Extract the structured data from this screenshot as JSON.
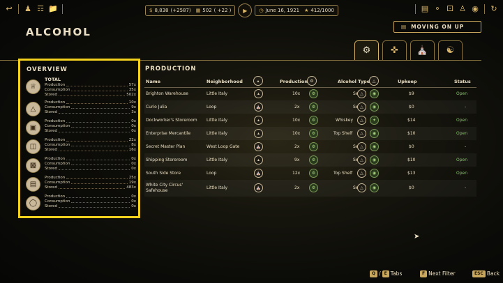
{
  "topbar": {
    "money": "8,838",
    "money_delta": "(+2587)",
    "workers": "502",
    "workers_delta": "( +22 )",
    "date": "June 16, 1921",
    "stars": "412/1000"
  },
  "page": {
    "title": "ALCOHOL"
  },
  "moving_on_up": {
    "label": "MOVING ON UP"
  },
  "overview": {
    "title": "OVERVIEW",
    "total_label": "TOTAL",
    "labels": {
      "production": "Production",
      "consumption": "Consumption",
      "stored": "Stored"
    },
    "items": [
      {
        "icon": "crown-icon",
        "production": "57x",
        "consumption": "35x",
        "stored": "502x"
      },
      {
        "icon": "bottle-icon",
        "production": "10x",
        "consumption": "9x",
        "stored": "3x"
      },
      {
        "icon": "crate-icon",
        "production": "0x",
        "consumption": "0x",
        "stored": "0x"
      },
      {
        "icon": "barrel-icon",
        "production": "22x",
        "consumption": "8x",
        "stored": "16x"
      },
      {
        "icon": "jug-icon",
        "production": "0x",
        "consumption": "0x",
        "stored": "0x"
      },
      {
        "icon": "keg-icon",
        "production": "25x",
        "consumption": "19x",
        "stored": "483x"
      },
      {
        "icon": "flask-icon",
        "production": "0x",
        "consumption": "0x",
        "stored": "0x"
      }
    ]
  },
  "production": {
    "title": "PRODUCTION",
    "columns": {
      "name": "Name",
      "neighborhood": "Neighborhood",
      "production": "Production",
      "alcohol_type": "Alcohol Type",
      "upkeep": "Upkeep",
      "status": "Status"
    },
    "rows": [
      {
        "name": "Brighton Warehouse",
        "neighborhood": "Little Italy",
        "production": "10x",
        "alcohol_type": "Swill",
        "upkeep": "$9",
        "status": "Open"
      },
      {
        "name": "Curio Julia",
        "neighborhood": "Loop",
        "production": "2x",
        "alcohol_type": "Swill",
        "upkeep": "$0",
        "status": "-"
      },
      {
        "name": "Dockworker's Storeroom",
        "neighborhood": "Little Italy",
        "production": "10x",
        "alcohol_type": "Whiskey",
        "upkeep": "$14",
        "status": "Open"
      },
      {
        "name": "Enterprise Mercantile",
        "neighborhood": "Little Italy",
        "production": "10x",
        "alcohol_type": "Top Shelf",
        "upkeep": "$10",
        "status": "Open"
      },
      {
        "name": "Secret Master Plan",
        "neighborhood": "West Loop Gate",
        "production": "2x",
        "alcohol_type": "Swill",
        "upkeep": "$0",
        "status": "-"
      },
      {
        "name": "Shipping Storeroom",
        "neighborhood": "Little Italy",
        "production": "9x",
        "alcohol_type": "Swill",
        "upkeep": "$10",
        "status": "Open"
      },
      {
        "name": "South Side Store",
        "neighborhood": "Loop",
        "production": "12x",
        "alcohol_type": "Top Shelf",
        "upkeep": "$13",
        "status": "Open"
      },
      {
        "name_line1": "White City Circus'",
        "name_line2": "Safehouse",
        "neighborhood": "Little Italy",
        "production": "2x",
        "alcohol_type": "Swill",
        "upkeep": "$0",
        "status": "-"
      }
    ]
  },
  "hints": {
    "tabs_keys": [
      "Q",
      "E"
    ],
    "tabs_label": "Tabs",
    "filter_key": "F",
    "filter_label": "Next Filter",
    "back_key": "ESC",
    "back_label": "Back"
  }
}
